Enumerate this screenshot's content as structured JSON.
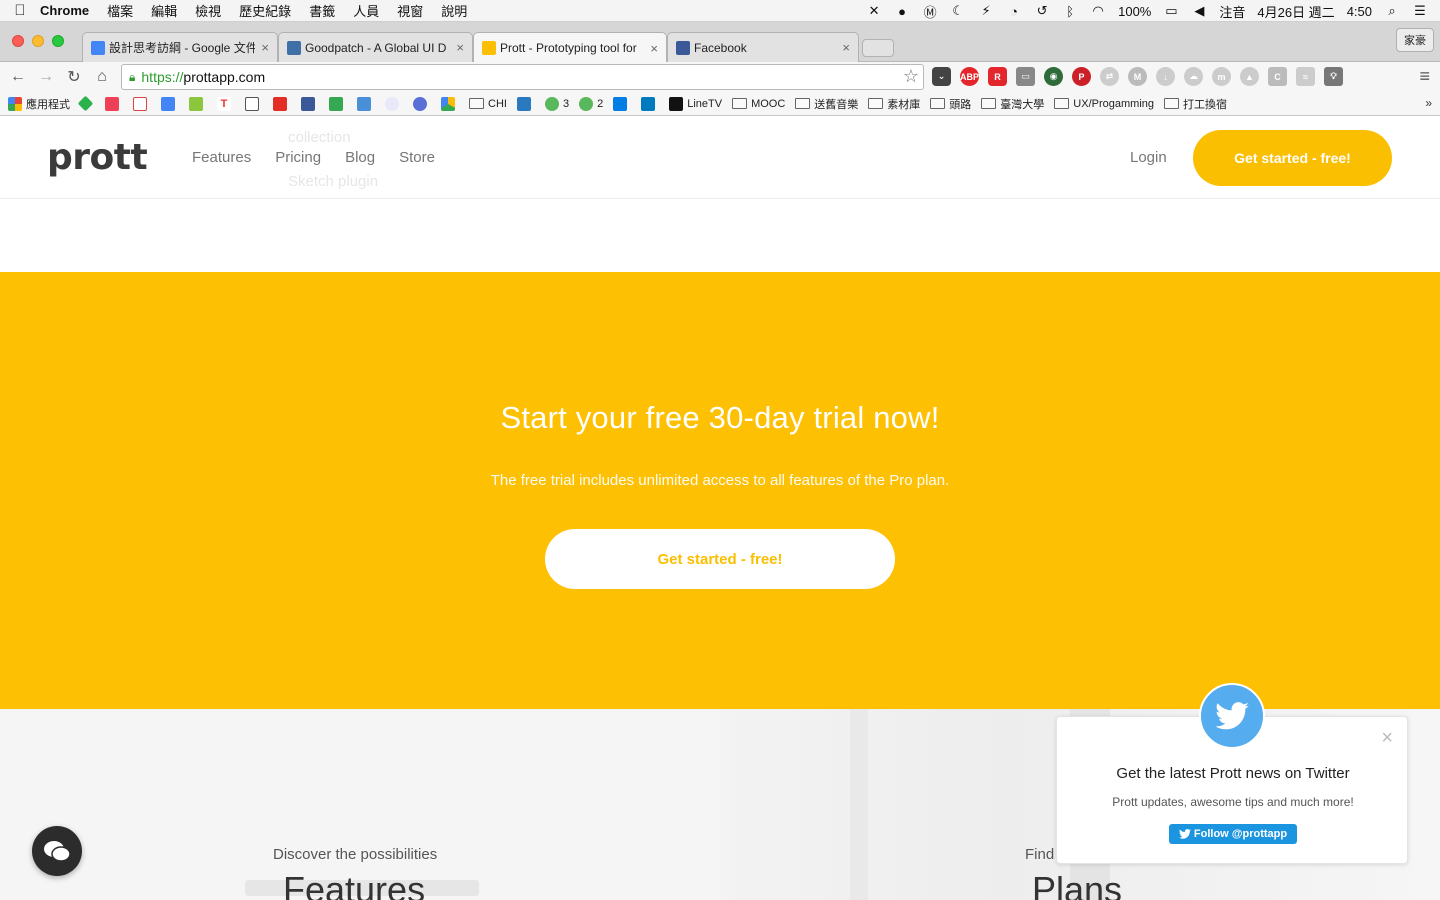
{
  "menubar": {
    "app_name": "Chrome",
    "items": [
      "檔案",
      "編輯",
      "檢視",
      "歷史紀錄",
      "書籤",
      "人員",
      "視窗",
      "說明"
    ],
    "battery": "100%",
    "input_method": "注音",
    "date": "4月26日 週二",
    "time": "4:50"
  },
  "tabs": [
    {
      "title": "設計思考訪綱 - Google 文件",
      "color": "#4285f4"
    },
    {
      "title": "Goodpatch - A Global UI D",
      "color": "#3f6fa6"
    },
    {
      "title": "Prott - Prototyping tool for",
      "color": "#fbbf02"
    },
    {
      "title": "Facebook",
      "color": "#3b5998"
    }
  ],
  "profile_label": "家豪",
  "address": {
    "scheme": "https://",
    "host": "prottapp.com"
  },
  "bookmarks": {
    "apps_label": "應用程式",
    "labeled": [
      "3",
      "2",
      "LineTV"
    ],
    "folders": [
      "CHI",
      "MOOC",
      "送舊音樂",
      "素材庫",
      "頭路",
      "臺灣大學",
      "UX/Progamming",
      "打工換宿"
    ],
    "more": "»"
  },
  "site": {
    "ghost_lines": [
      "collection",
      "Sketch plugin"
    ],
    "logo": "prott",
    "nav": [
      "Features",
      "Pricing",
      "Blog",
      "Store"
    ],
    "login": "Login",
    "header_cta": "Get started - free!"
  },
  "trial": {
    "heading": "Start your free 30-day trial now!",
    "subtext": "The free trial includes unlimited access to all features of the Pro plan.",
    "cta": "Get started - free!"
  },
  "lower": {
    "left_kicker": "Discover the possibilities",
    "left_title": "Features",
    "right_kicker": "Find the right fit",
    "right_title": "Plans"
  },
  "twitter_popup": {
    "title": "Get the latest Prott news on Twitter",
    "subtitle": "Prott updates, awesome tips and much more!",
    "follow_label": "Follow @prottapp",
    "close_symbol": "×"
  },
  "colors": {
    "brand_yellow": "#fdc003",
    "twitter_blue": "#55acee"
  }
}
